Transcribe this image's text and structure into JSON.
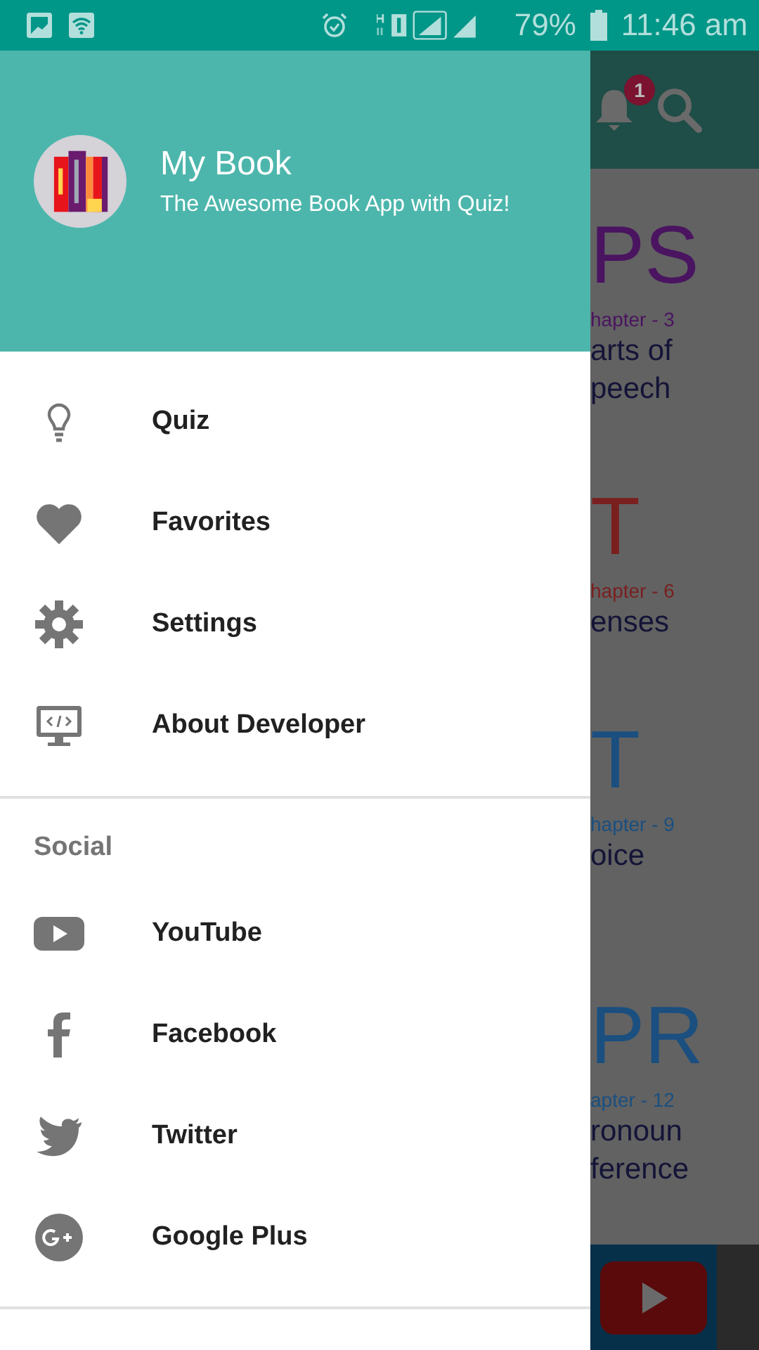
{
  "status_bar": {
    "battery": "79%",
    "time": "11:46 am"
  },
  "drawer": {
    "header": {
      "title": "My Book",
      "subtitle": "The Awesome Book App with Quiz!"
    },
    "items": [
      {
        "label": "Quiz"
      },
      {
        "label": "Favorites"
      },
      {
        "label": "Settings"
      },
      {
        "label": "About Developer"
      }
    ],
    "social": {
      "heading": "Social",
      "items": [
        {
          "label": "YouTube"
        },
        {
          "label": "Facebook"
        },
        {
          "label": "Twitter"
        },
        {
          "label": "Google Plus"
        }
      ]
    }
  },
  "background": {
    "notification_badge": "1",
    "cards": [
      {
        "abbr": "PS",
        "chapter": "hapter - 3",
        "title": [
          "arts of",
          "peech"
        ],
        "color": "#4a1460"
      },
      {
        "abbr": "T",
        "chapter": "hapter - 6",
        "title": [
          "enses"
        ],
        "color": "#7a1f1f"
      },
      {
        "abbr": "T",
        "chapter": "hapter - 9",
        "title": [
          "oice"
        ],
        "color": "#1a4f80"
      },
      {
        "abbr": "PR",
        "chapter": "apter - 12",
        "title": [
          "ronoun",
          "ference"
        ],
        "color": "#1a4f80"
      }
    ]
  }
}
